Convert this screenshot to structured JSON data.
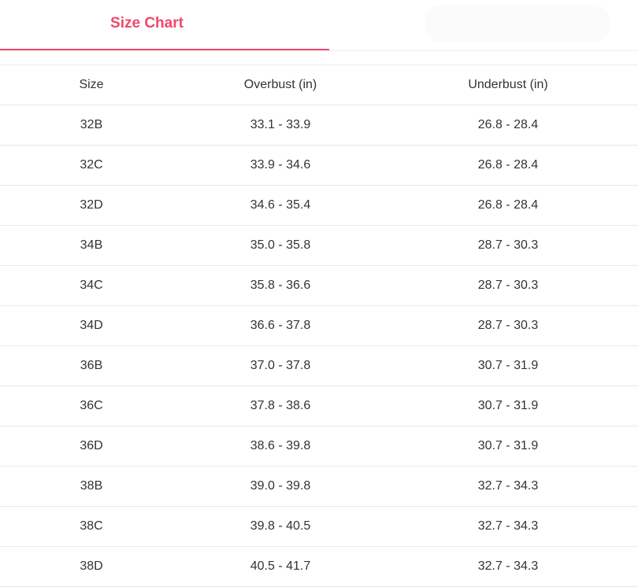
{
  "tabs": {
    "active_label": "Size Chart",
    "inactive_label": ""
  },
  "colors": {
    "accent": "#f0476e",
    "text": "#333333",
    "row_border": "#e9e9e9"
  },
  "table": {
    "headers": {
      "size": "Size",
      "overbust": "Overbust (in)",
      "underbust": "Underbust (in)"
    },
    "rows": [
      {
        "size": "32B",
        "overbust": "33.1 - 33.9",
        "underbust": "26.8 - 28.4"
      },
      {
        "size": "32C",
        "overbust": "33.9 - 34.6",
        "underbust": "26.8 - 28.4"
      },
      {
        "size": "32D",
        "overbust": "34.6 - 35.4",
        "underbust": "26.8 - 28.4"
      },
      {
        "size": "34B",
        "overbust": "35.0 - 35.8",
        "underbust": "28.7 - 30.3"
      },
      {
        "size": "34C",
        "overbust": "35.8 - 36.6",
        "underbust": "28.7 - 30.3"
      },
      {
        "size": "34D",
        "overbust": "36.6 - 37.8",
        "underbust": "28.7 - 30.3"
      },
      {
        "size": "36B",
        "overbust": "37.0 - 37.8",
        "underbust": "30.7 - 31.9"
      },
      {
        "size": "36C",
        "overbust": "37.8 - 38.6",
        "underbust": "30.7 - 31.9"
      },
      {
        "size": "36D",
        "overbust": "38.6 - 39.8",
        "underbust": "30.7 - 31.9"
      },
      {
        "size": "38B",
        "overbust": "39.0 - 39.8",
        "underbust": "32.7 - 34.3"
      },
      {
        "size": "38C",
        "overbust": "39.8 - 40.5",
        "underbust": "32.7 - 34.3"
      },
      {
        "size": "38D",
        "overbust": "40.5 - 41.7",
        "underbust": "32.7 - 34.3"
      }
    ]
  }
}
